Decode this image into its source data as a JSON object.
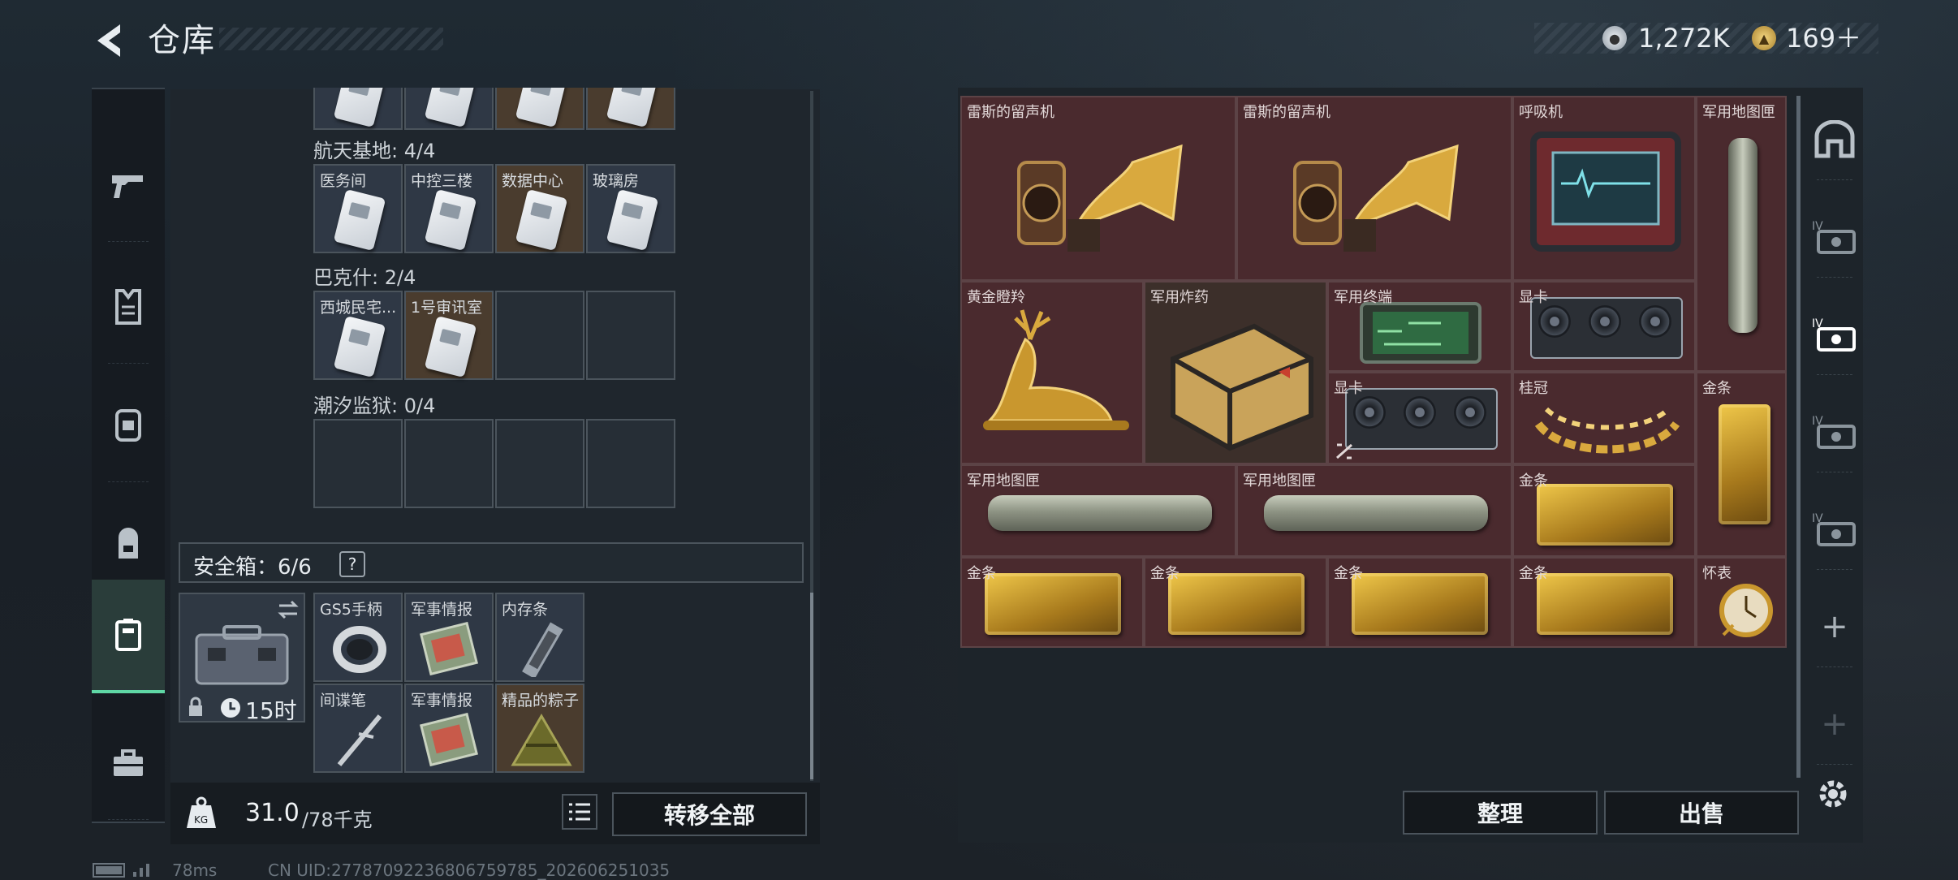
{
  "header": {
    "title": "仓库"
  },
  "currency": {
    "silver": {
      "icon": "silver-coin-icon",
      "value": "1,272K"
    },
    "gold": {
      "icon": "gold-coin-icon",
      "value": "169＋"
    }
  },
  "left_rail": {
    "items": [
      {
        "name": "weapons",
        "icon": "gun-icon"
      },
      {
        "name": "armor",
        "icon": "vest-icon"
      },
      {
        "name": "helmet",
        "icon": "chest-rig-icon"
      },
      {
        "name": "backpack",
        "icon": "backpack-icon"
      },
      {
        "name": "safe-box",
        "icon": "safe-box-icon",
        "active": true
      },
      {
        "name": "toolbox",
        "icon": "toolbox-icon"
      }
    ]
  },
  "collections": [
    {
      "label": "航天基地: 4/4",
      "cells": [
        {
          "label": "医务间",
          "item": "keycard",
          "bg": "filled"
        },
        {
          "label": "中控三楼",
          "item": "keycard",
          "bg": "filled"
        },
        {
          "label": "数据中心",
          "item": "keycard",
          "bg": "brown"
        },
        {
          "label": "玻璃房",
          "item": "keycard",
          "bg": "filled"
        }
      ]
    },
    {
      "label": "巴克什: 2/4",
      "cells": [
        {
          "label": "西城民宅...",
          "item": "keycard",
          "bg": "filled"
        },
        {
          "label": "1号审讯室",
          "item": "keycard",
          "bg": "brown"
        },
        {
          "label": "",
          "item": "",
          "bg": "empty"
        },
        {
          "label": "",
          "item": "",
          "bg": "empty"
        }
      ]
    },
    {
      "label": "潮汐监狱: 0/4",
      "cells": [
        {
          "label": "",
          "item": "",
          "bg": "empty"
        },
        {
          "label": "",
          "item": "",
          "bg": "empty"
        },
        {
          "label": "",
          "item": "",
          "bg": "empty"
        },
        {
          "label": "",
          "item": "",
          "bg": "empty"
        }
      ]
    }
  ],
  "safe_box": {
    "label": "安全箱：6/6",
    "help": "?",
    "timer": "15时",
    "items": [
      {
        "label": "GS5手柄"
      },
      {
        "label": "军事情报"
      },
      {
        "label": "内存条"
      },
      {
        "label": "间谍笔"
      },
      {
        "label": "军事情报"
      },
      {
        "label": "精品的粽子"
      }
    ]
  },
  "weight": {
    "icon": "weight-kg-icon",
    "current": "31.0",
    "max": "/78千克"
  },
  "buttons": {
    "transfer_all": "转移全部",
    "sort": "整理",
    "sell": "出售"
  },
  "inventory": {
    "items": [
      {
        "label": "雷斯的留声机"
      },
      {
        "label": "雷斯的留声机"
      },
      {
        "label": "呼吸机"
      },
      {
        "label": "军用地图匣"
      },
      {
        "label": "黄金瞪羚"
      },
      {
        "label": "军用炸药"
      },
      {
        "label": "军用终端"
      },
      {
        "label": "显卡"
      },
      {
        "label": "显卡"
      },
      {
        "label": "桂冠"
      },
      {
        "label": "金条"
      },
      {
        "label": "军用地图匣"
      },
      {
        "label": "军用地图匣"
      },
      {
        "label": "金条"
      },
      {
        "label": "金条"
      },
      {
        "label": "金条"
      },
      {
        "label": "金条"
      },
      {
        "label": "金条"
      },
      {
        "label": "怀表"
      }
    ]
  },
  "right_rail": {
    "items": [
      {
        "icon": "home-icon"
      },
      {
        "icon": "tier4-case-icon",
        "tier": "IV"
      },
      {
        "icon": "tier4-case-icon",
        "tier": "IV",
        "active": true
      },
      {
        "icon": "tier4-case-icon",
        "tier": "IV"
      },
      {
        "icon": "tier4-case-icon",
        "tier": "IV"
      },
      {
        "icon": "add-icon",
        "label": "+"
      },
      {
        "icon": "add-icon",
        "label": "+"
      }
    ],
    "settings_icon": "gear-icon"
  },
  "status": {
    "ping": "78ms",
    "uid": "CN UID:27787092236806759785_202606251035"
  }
}
